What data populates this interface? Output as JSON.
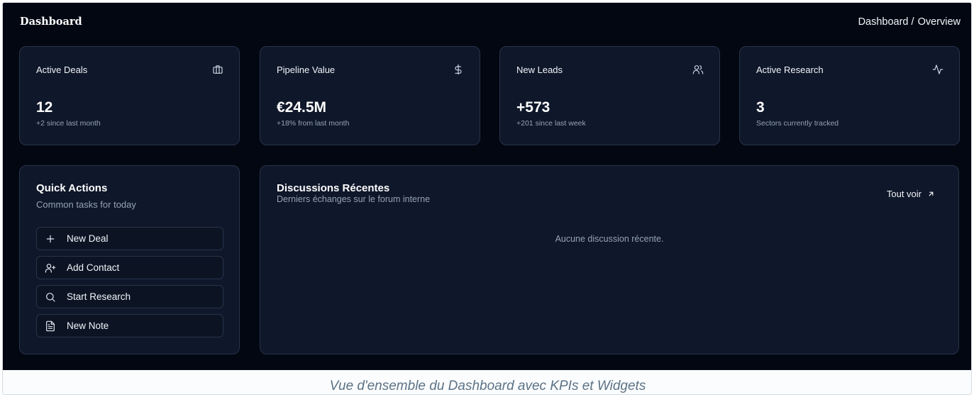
{
  "header": {
    "title": "Dashboard",
    "breadcrumb": [
      "Dashboard /",
      "Overview"
    ]
  },
  "kpis": [
    {
      "label": "Active Deals",
      "value": "12",
      "sub": "+2 since last month",
      "icon": "briefcase-icon"
    },
    {
      "label": "Pipeline Value",
      "value": "€24.5M",
      "sub": "+18% from last month",
      "icon": "dollar-icon"
    },
    {
      "label": "New Leads",
      "value": "+573",
      "sub": "+201 since last week",
      "icon": "users-icon"
    },
    {
      "label": "Active Research",
      "value": "3",
      "sub": "Sectors currently tracked",
      "icon": "activity-icon"
    }
  ],
  "quick_actions": {
    "title": "Quick Actions",
    "subtitle": "Common tasks for today",
    "items": [
      {
        "label": "New Deal",
        "icon": "plus-icon"
      },
      {
        "label": "Add Contact",
        "icon": "user-plus-icon"
      },
      {
        "label": "Start Research",
        "icon": "search-icon"
      },
      {
        "label": "New Note",
        "icon": "file-text-icon"
      }
    ]
  },
  "discussions": {
    "title": "Discussions Récentes",
    "subtitle": "Derniers échanges sur le forum interne",
    "view_all": "Tout voir",
    "empty": "Aucune discussion récente."
  },
  "caption": "Vue d'ensemble du Dashboard avec KPIs et Widgets",
  "colors": {
    "background": "#030712",
    "card": "#0f172a",
    "border": "#273449",
    "text": "#f1f5f9",
    "muted": "#94a3b8"
  }
}
